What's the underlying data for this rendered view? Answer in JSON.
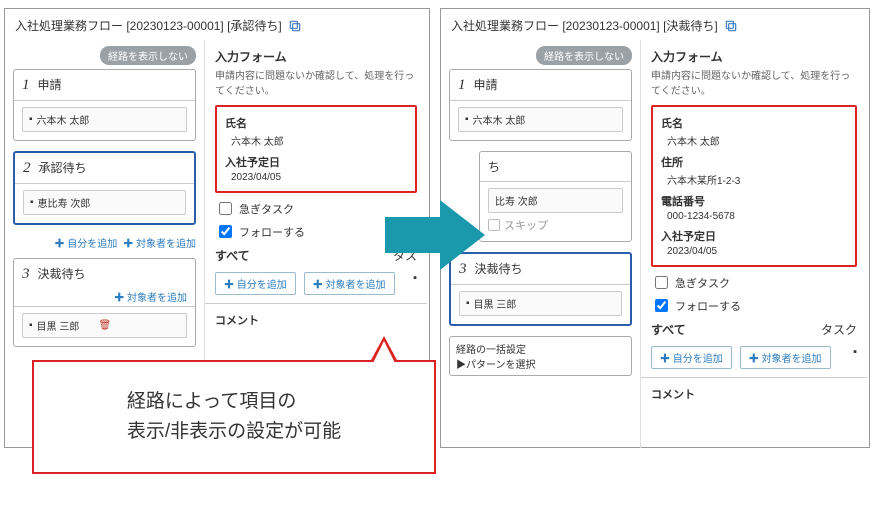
{
  "left": {
    "title": "入社処理業務フロー   [20230123-00001] [承認待ち]",
    "hide_route_btn": "経路を表示しない",
    "steps": [
      {
        "num": "1",
        "title": "申請",
        "person": "六本木 太郎"
      },
      {
        "num": "2",
        "title": "承認待ち",
        "person": "恵比寿 次郎",
        "selected": true,
        "add_self": "自分を追加",
        "add_target": "対象者を追加"
      },
      {
        "num": "3",
        "title": "決裁待ち",
        "person": "目黒 三郎",
        "add_target": "対象者を追加"
      }
    ],
    "form": {
      "title": "入力フォーム",
      "sub": "申請内容に問題ないか確認して、処理を行ってください。",
      "fields": [
        {
          "label": "氏名",
          "value": "六本木 太郎"
        },
        {
          "label": "入社予定日",
          "value": "2023/04/05"
        }
      ],
      "urgent": "急ぎタスク",
      "follow": "フォローする",
      "tab_all": "すべて",
      "tab_task": "タス",
      "btn_self": "自分を追加",
      "btn_target": "対象者を追加",
      "comment": "コメント"
    }
  },
  "right": {
    "title": "入社処理業務フロー   [20230123-00001] [決裁待ち]",
    "hide_route_btn": "経路を表示しない",
    "steps": [
      {
        "num": "1",
        "title": "申請",
        "person": "六本木 太郎"
      },
      {
        "num": "",
        "title": "ち",
        "person": "比寿 次郎",
        "skip": "スキップ"
      },
      {
        "num": "3",
        "title": "決裁待ち",
        "person": "目黒 三郎",
        "selected": true
      }
    ],
    "batch": {
      "label": "経路の一括設定",
      "select": "▶パターンを選択"
    },
    "form": {
      "title": "入力フォーム",
      "sub": "申請内容に問題ないか確認して、処理を行ってください。",
      "fields": [
        {
          "label": "氏名",
          "value": "六本木 太郎"
        },
        {
          "label": "住所",
          "value": "六本木某所1-2-3"
        },
        {
          "label": "電話番号",
          "value": "000-1234-5678"
        },
        {
          "label": "入社予定日",
          "value": "2023/04/05"
        }
      ],
      "urgent": "急ぎタスク",
      "follow": "フォローする",
      "tab_all": "すべて",
      "tab_task": "タスク",
      "btn_self": "自分を追加",
      "btn_target": "対象者を追加",
      "comment": "コメント"
    }
  },
  "callout": "経路によって項目の\n表示/非表示の設定が可能",
  "icons": {
    "plus": "✚",
    "user": "👤"
  }
}
